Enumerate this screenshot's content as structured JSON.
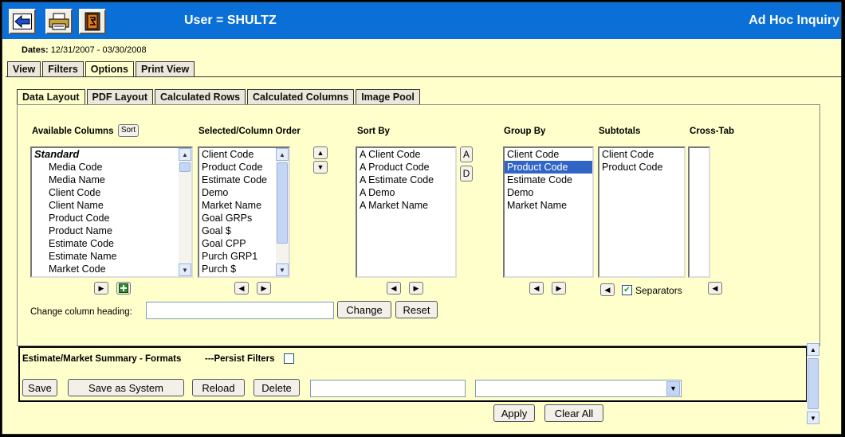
{
  "header": {
    "user_text": "User = SHULTZ",
    "app_title": "Ad Hoc Inquiry",
    "toolbar": [
      {
        "icon": "back-arrow-icon"
      },
      {
        "icon": "print-icon"
      },
      {
        "icon": "exit-door-icon"
      }
    ]
  },
  "dates": {
    "label": "Dates:",
    "value": "12/31/2007 - 03/30/2008"
  },
  "main_tabs": [
    "View",
    "Filters",
    "Options",
    "Print View"
  ],
  "main_tabs_active": "Options",
  "sub_tabs": [
    "Data Layout",
    "PDF Layout",
    "Calculated Rows",
    "Calculated Columns",
    "Image Pool"
  ],
  "sub_tabs_active": "Data Layout",
  "available_columns": {
    "label": "Available Columns",
    "sort_button": "Sort",
    "group": "Standard",
    "items": [
      "Media Code",
      "Media Name",
      "Client Code",
      "Client Name",
      "Product Code",
      "Product Name",
      "Estimate Code",
      "Estimate Name",
      "Market Code"
    ]
  },
  "selected_columns": {
    "label": "Selected/Column Order",
    "items": [
      "Client Code",
      "Product Code",
      "Estimate Code",
      "Demo",
      "Market Name",
      "Goal GRPs",
      "Goal $",
      "Goal CPP",
      "Purch GRP1",
      "Purch $"
    ]
  },
  "sort_by": {
    "label": "Sort By",
    "asc_label": "A",
    "desc_label": "D",
    "items": [
      "A Client Code",
      "A Product Code",
      "A Estimate Code",
      "A Demo",
      "A Market Name"
    ]
  },
  "group_by": {
    "label": "Group By",
    "items": [
      "Client Code",
      "Product Code",
      "Estimate Code",
      "Demo",
      "Market Name"
    ],
    "selected": "Product Code"
  },
  "subtotals": {
    "label": "Subtotals",
    "items": [
      "Client Code",
      "Product Code"
    ],
    "separators_label": "Separators",
    "separators_checked": true
  },
  "cross_tab": {
    "label": "Cross-Tab",
    "items": []
  },
  "heading": {
    "label": "Change column heading:",
    "value": "",
    "change_button": "Change",
    "reset_button": "Reset"
  },
  "summary": {
    "format_name": "Estimate/Market Summary - Formats",
    "persist_label": "---Persist Filters",
    "persist_checked": false,
    "save": "Save",
    "save_system": "Save as System",
    "reload": "Reload",
    "delete": "Delete",
    "name_value": "",
    "select_value": ""
  },
  "footer": {
    "apply": "Apply",
    "clear_all": "Clear All"
  },
  "colors": {
    "header_blue": "#0a6fd6",
    "background": "#ffffcc",
    "selection": "#3165c5"
  }
}
